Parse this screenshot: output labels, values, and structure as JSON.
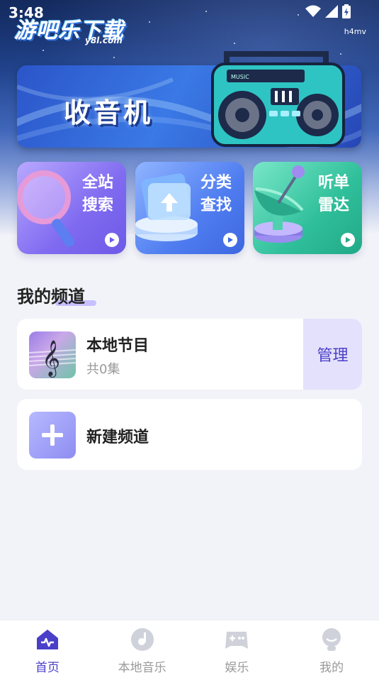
{
  "status_bar": {
    "time": "3:48",
    "device_tag": "h4mv"
  },
  "watermark": {
    "main": "游吧乐下载",
    "sub": "y8l.com"
  },
  "banner": {
    "title": "收音机",
    "device_label": "MUSIC"
  },
  "quick_cards": [
    {
      "label": "全站搜索",
      "line1": "全站",
      "line2": "搜索",
      "icon": "magnifier-icon"
    },
    {
      "label": "分类查找",
      "line1": "分类",
      "line2": "查找",
      "icon": "folder-icon"
    },
    {
      "label": "听单雷达",
      "line1": "听单",
      "line2": "雷达",
      "icon": "radar-dish-icon"
    }
  ],
  "section": {
    "title": "我的频道"
  },
  "channels": [
    {
      "name": "本地节目",
      "count": "共0集",
      "manage_label": "管理"
    }
  ],
  "new_channel": {
    "label": "新建频道"
  },
  "bottom_nav": [
    {
      "label": "首页",
      "icon": "home-pulse-icon",
      "active": true
    },
    {
      "label": "本地音乐",
      "icon": "disc-icon",
      "active": false
    },
    {
      "label": "娱乐",
      "icon": "gamepad-icon",
      "active": false
    },
    {
      "label": "我的",
      "icon": "profile-icon",
      "active": false
    }
  ],
  "colors": {
    "accent": "#4a3fc9",
    "manage_bg": "#e4e1fc",
    "inactive_nav": "#999999"
  }
}
